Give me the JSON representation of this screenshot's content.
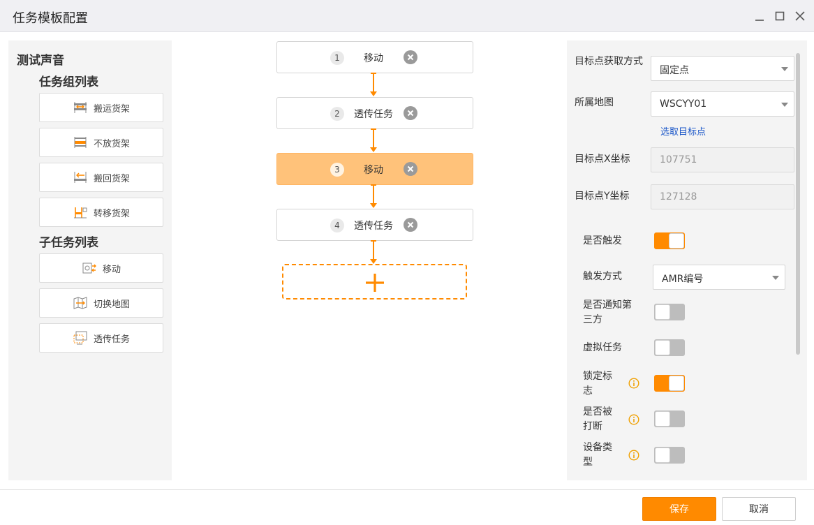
{
  "window": {
    "title": "任务模板配置"
  },
  "left": {
    "test_sound": "测试声音",
    "task_group_title": "任务组列表",
    "task_groups": [
      {
        "label": "搬运货架",
        "icon": "transport-shelf-icon"
      },
      {
        "label": "不放货架",
        "icon": "no-place-shelf-icon"
      },
      {
        "label": "搬回货架",
        "icon": "return-shelf-icon"
      },
      {
        "label": "转移货架",
        "icon": "transfer-shelf-icon"
      }
    ],
    "subtask_title": "子任务列表",
    "subtasks": [
      {
        "label": "移动",
        "icon": "move-icon"
      },
      {
        "label": "切换地图",
        "icon": "switch-map-icon"
      },
      {
        "label": "透传任务",
        "icon": "passthrough-task-icon"
      }
    ]
  },
  "flow": {
    "steps": [
      {
        "num": "1",
        "label": "移动"
      },
      {
        "num": "2",
        "label": "透传任务"
      },
      {
        "num": "3",
        "label": "移动"
      },
      {
        "num": "4",
        "label": "透传任务"
      }
    ],
    "active_step": 3
  },
  "right": {
    "target_method_label": "目标点获取方式",
    "target_method_value": "固定点",
    "map_label": "所属地图",
    "map_value": "WSCYY01",
    "select_target_link": "选取目标点",
    "x_label": "目标点X坐标",
    "x_value": "107751",
    "y_label": "目标点Y坐标",
    "y_value": "127128",
    "trigger_label": "是否触发",
    "trigger_on": true,
    "trigger_method_label": "触发方式",
    "trigger_method_value": "AMR编号",
    "notify_label": "是否通知第三方",
    "notify_on": false,
    "virtual_label": "虚拟任务",
    "virtual_on": false,
    "lock_label": "锁定标志",
    "lock_on": true,
    "interrupt_label": "是否被打断",
    "interrupt_on": false,
    "device_type_label": "设备类型",
    "device_type_on": false
  },
  "footer": {
    "save": "保存",
    "cancel": "取消"
  },
  "colors": {
    "accent": "#ff8a00",
    "active_step": "#ffc27a",
    "link": "#1a56c8"
  }
}
